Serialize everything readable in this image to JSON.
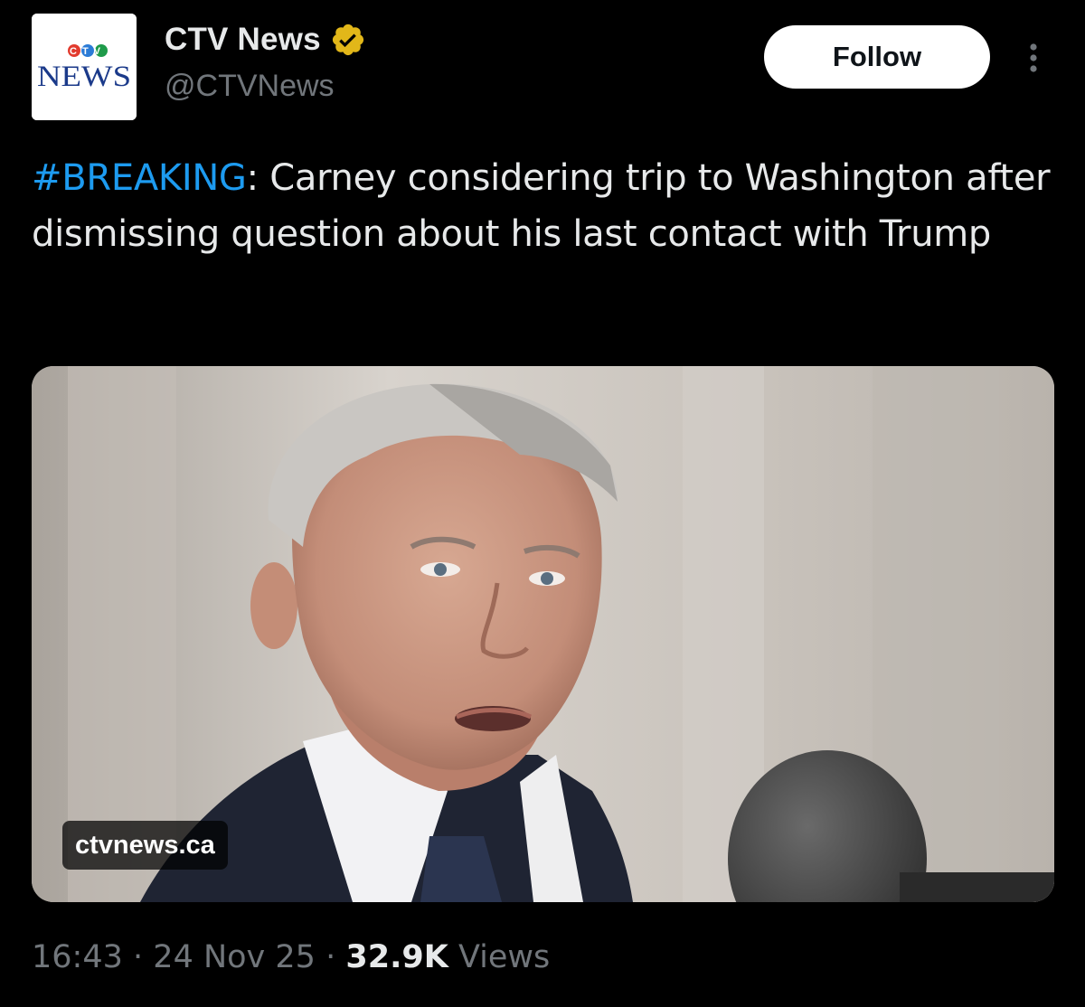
{
  "author": {
    "display_name": "CTV News",
    "handle": "@CTVNews",
    "avatar_brand_top": "CTV",
    "avatar_brand_bottom": "NEWS",
    "verified_icon": "gold-verified-badge"
  },
  "header": {
    "follow_label": "Follow",
    "more_icon": "more-vertical-icon"
  },
  "tweet": {
    "hashtag": "#BREAKING",
    "body": ": Carney considering trip to Washington after dismissing question about his last contact with Trump"
  },
  "media": {
    "source_label": "ctvnews.ca"
  },
  "meta": {
    "time": "16:43",
    "separator": "·",
    "date": "24 Nov 25",
    "views_count": "32.9K",
    "views_label": "Views"
  },
  "colors": {
    "background": "#000000",
    "text": "#e7e9ea",
    "muted": "#71767b",
    "link": "#1d9bf0",
    "verified_gold": "#e2b719"
  }
}
